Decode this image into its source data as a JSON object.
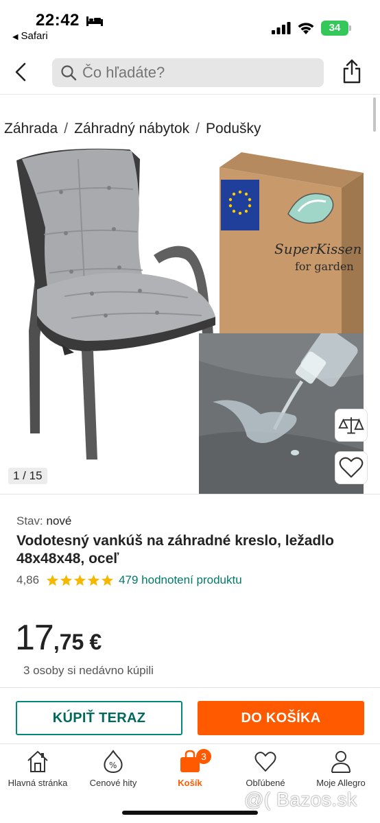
{
  "status_bar": {
    "time": "22:42",
    "back_app": "Safari",
    "battery": "34",
    "colors": {
      "battery": "#34c759"
    }
  },
  "header": {
    "search_placeholder": "Čo hľadáte?"
  },
  "breadcrumb": [
    "Záhrada",
    "Záhradný nábytok",
    "Podušky"
  ],
  "gallery": {
    "counter": "1 / 15",
    "box_brand": "SuperKissen",
    "box_sub": "for garden"
  },
  "product": {
    "condition_label": "Stav:",
    "condition_value": "nové",
    "title": "Vodotesný vankúš na záhradné kreslo, ležadlo 48x48x48, oceľ",
    "rating": "4,86",
    "stars": 5,
    "reviews": "479 hodnotení produktu",
    "price_int": "17",
    "price_cents": ",75",
    "currency": "€",
    "recent_buyers": "3 osoby si nedávno kúpili"
  },
  "actions": {
    "buy_now": "KÚPIŤ TERAZ",
    "add_to_cart": "DO KOŠÍKA"
  },
  "tabbar": {
    "items": [
      {
        "label": "Hlavná stránka",
        "icon": "home-icon"
      },
      {
        "label": "Cenové hity",
        "icon": "price-tag-icon"
      },
      {
        "label": "Košík",
        "icon": "cart-icon",
        "badge": "3",
        "active": true
      },
      {
        "label": "Obľúbené",
        "icon": "heart-icon"
      },
      {
        "label": "Moje Allegro",
        "icon": "user-icon"
      }
    ]
  },
  "watermark": "@( Bazos.sk",
  "colors": {
    "accent": "#ff5a00",
    "teal": "#00897b",
    "star": "#f5b800"
  }
}
